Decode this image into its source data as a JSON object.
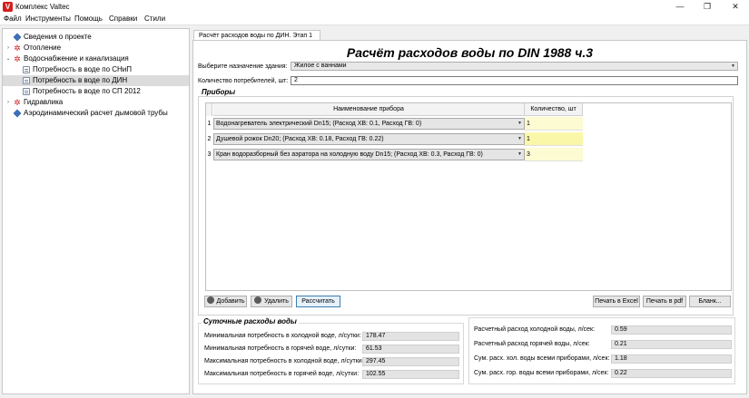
{
  "window": {
    "title": "Комплекс Valtec",
    "logo_letter": "V",
    "minimize": "—",
    "maximize": "❐",
    "close": "✕"
  },
  "menu": [
    "Файл",
    "Инструменты",
    "Помощь",
    "Справки",
    "Стили"
  ],
  "tree": [
    {
      "label": "Сведения о проекте",
      "icon": "blue-diamond-icon"
    },
    {
      "label": "Отопление",
      "icon": "gear-icon",
      "expander": "›"
    },
    {
      "label": "Водоснабжение и канализация",
      "icon": "gear-icon",
      "expander": "⌄"
    },
    {
      "label": "Потребность в воде по СНиП",
      "icon": "document-icon"
    },
    {
      "label": "Потребность в воде по ДИН",
      "icon": "document-icon",
      "selected": true
    },
    {
      "label": "Потребность в воде по СП 2012",
      "icon": "document-icon"
    },
    {
      "label": "Гидравлика",
      "icon": "gear-icon",
      "expander": "›"
    },
    {
      "label": "Аэродинамический расчет дымовой трубы",
      "icon": "blue-diamond-icon"
    }
  ],
  "tab": {
    "label": "Расчёт расходов воды по ДИН. Этап 1"
  },
  "main": {
    "title": "Расчёт расходов воды по DIN 1988 ч.3",
    "building_label": "Выберите назначение здания:",
    "building_value": "Жилое с ваннами",
    "consumers_label": "Количество потребителей, шт:",
    "consumers_value": "2"
  },
  "devices": {
    "section_title": "Приборы",
    "col_name": "Наименование прибора",
    "col_qty": "Количество, шт",
    "rows": [
      {
        "num": "1",
        "name": "Водонагреватель электрический Dn15; (Расход ХВ: 0.1, Расход ГВ: 0)",
        "qty": "1"
      },
      {
        "num": "2",
        "name": "Душевой  рожок  Dn20; (Расход ХВ: 0.18, Расход ГВ: 0.22)",
        "qty": "1"
      },
      {
        "num": "3",
        "name": "Кран водоразборный без аэратора  на холодную воду  Dn15; (Расход ХВ: 0.3, Расход ГВ: 0)",
        "qty": "3"
      }
    ]
  },
  "buttons": {
    "add": "Добавить",
    "delete": "Удалить",
    "calculate": "Рассчитать",
    "print_excel": "Печать в Excel",
    "print_pdf": "Печать в pdf",
    "blank": "Бланк..."
  },
  "daily": {
    "section_title": "Суточные расходы воды",
    "rows": [
      {
        "label": "Минимальная потребность в холодной воде, л/сутки:",
        "value": "178.47"
      },
      {
        "label": "Минимальная потребность в горячей воде, л/сутки:",
        "value": "61.53"
      },
      {
        "label": "Максимальная потребность в холодной воде, л/сутки:",
        "value": "297.45"
      },
      {
        "label": "Максимальная потребность в горячей воде, л/сутки:",
        "value": "102.55"
      }
    ]
  },
  "calc": {
    "rows": [
      {
        "label": "Расчетный расход холодной воды, л/сек:",
        "value": "0.59"
      },
      {
        "label": "Расчетный расход горячей воды, л/сек:",
        "value": "0.21"
      },
      {
        "label": "Сум. расх. хол. воды всеми приборами, л/сек:",
        "value": "1.18"
      },
      {
        "label": "Сум. расх. гор. воды всеми приборами, л/сек:",
        "value": "0.22"
      }
    ]
  },
  "colors": {
    "accent": "#3c7fb1",
    "qty_highlight": "#fdfbd2",
    "logo": "#d41f1f"
  }
}
